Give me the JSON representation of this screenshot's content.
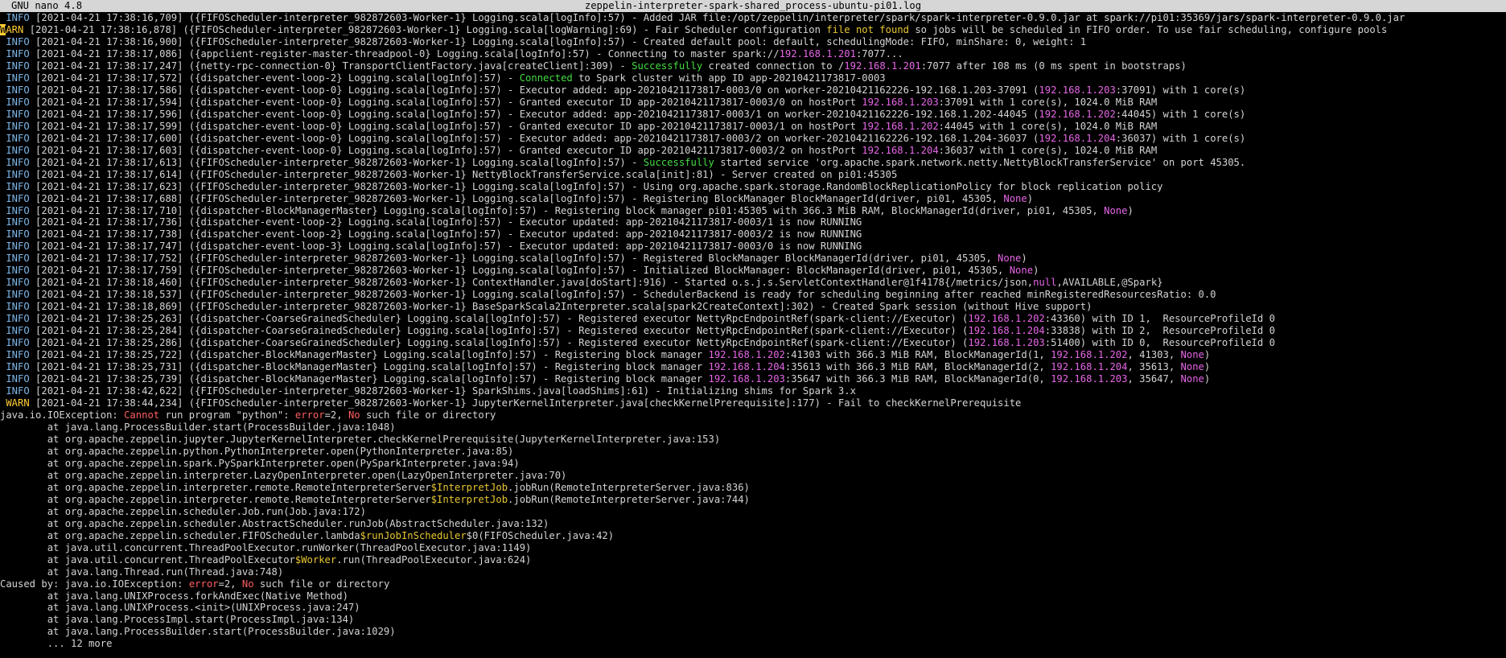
{
  "titlebar": {
    "app": "GNU nano 4.8",
    "filename": "zeppelin-interpreter-spark-shared_process-ubuntu-pi01.log"
  },
  "colors": {
    "background": "#000000",
    "titlebar_bg": "#d6d6d6",
    "plain": "#d4d4d4",
    "info": "#7eb6e8",
    "warn": "#ffcc33",
    "red": "#ff5f5f",
    "magenta": "#e666e6",
    "green": "#44dd44",
    "yellow": "#e8c832"
  },
  "lines": [
    [
      [
        "info",
        " INFO"
      ],
      [
        "",
        " [2021-04-21 17:38:16,709] ({FIFOScheduler-interpreter_982872603-Worker-1} Logging.scala[logInfo]:57) - Added JAR file:/opt/zeppelin/interpreter/spark/spark-interpreter-0.9.0.jar at spark://pi01:35369/jars/spark-interpreter-0.9.0.jar"
      ]
    ],
    [
      [
        "cursor",
        "W"
      ],
      [
        "warn",
        "ARN"
      ],
      [
        "",
        " [2021-04-21 17:38:16,878] ({FIFOScheduler-interpreter_982872603-Worker-1} Logging.scala[logWarning]:69) - Fair Scheduler configuration "
      ],
      [
        "yel",
        "file not found"
      ],
      [
        "",
        " so jobs will be scheduled in FIFO order. To use fair scheduling, configure pools"
      ]
    ],
    [
      [
        "info",
        " INFO"
      ],
      [
        "",
        " [2021-04-21 17:38:16,900] ({FIFOScheduler-interpreter_982872603-Worker-1} Logging.scala[logInfo]:57) - Created default pool: default, schedulingMode: FIFO, minShare: 0, weight: 1"
      ]
    ],
    [
      [
        "info",
        " INFO"
      ],
      [
        "",
        " [2021-04-21 17:38:17,086] ({appclient-register-master-threadpool-0} Logging.scala[logInfo]:57) - Connecting to master spark://"
      ],
      [
        "mag",
        "192.168.1.201"
      ],
      [
        "",
        ":7077..."
      ]
    ],
    [
      [
        "info",
        " INFO"
      ],
      [
        "",
        " [2021-04-21 17:38:17,247] ({netty-rpc-connection-0} TransportClientFactory.java[createClient]:309) - "
      ],
      [
        "grn",
        "Successfully"
      ],
      [
        "",
        " created connection to /"
      ],
      [
        "mag",
        "192.168.1.201"
      ],
      [
        "",
        ":7077 after 108 ms (0 ms spent in bootstraps)"
      ]
    ],
    [
      [
        "info",
        " INFO"
      ],
      [
        "",
        " [2021-04-21 17:38:17,572] ({dispatcher-event-loop-2} Logging.scala[logInfo]:57) - "
      ],
      [
        "grn",
        "Connected"
      ],
      [
        "",
        " to Spark cluster with app ID app-20210421173817-0003"
      ]
    ],
    [
      [
        "info",
        " INFO"
      ],
      [
        "",
        " [2021-04-21 17:38:17,586] ({dispatcher-event-loop-0} Logging.scala[logInfo]:57) - Executor added: app-20210421173817-0003/0 on worker-20210421162226-192.168.1.203-37091 ("
      ],
      [
        "mag",
        "192.168.1.203"
      ],
      [
        "",
        ":37091) with 1 core(s)"
      ]
    ],
    [
      [
        "info",
        " INFO"
      ],
      [
        "",
        " [2021-04-21 17:38:17,594] ({dispatcher-event-loop-0} Logging.scala[logInfo]:57) - Granted executor ID app-20210421173817-0003/0 on hostPort "
      ],
      [
        "mag",
        "192.168.1.203"
      ],
      [
        "",
        ":37091 with 1 core(s), 1024.0 MiB RAM"
      ]
    ],
    [
      [
        "info",
        " INFO"
      ],
      [
        "",
        " [2021-04-21 17:38:17,596] ({dispatcher-event-loop-0} Logging.scala[logInfo]:57) - Executor added: app-20210421173817-0003/1 on worker-20210421162226-192.168.1.202-44045 ("
      ],
      [
        "mag",
        "192.168.1.202"
      ],
      [
        "",
        ":44045) with 1 core(s)"
      ]
    ],
    [
      [
        "info",
        " INFO"
      ],
      [
        "",
        " [2021-04-21 17:38:17,599] ({dispatcher-event-loop-0} Logging.scala[logInfo]:57) - Granted executor ID app-20210421173817-0003/1 on hostPort "
      ],
      [
        "mag",
        "192.168.1.202"
      ],
      [
        "",
        ":44045 with 1 core(s), 1024.0 MiB RAM"
      ]
    ],
    [
      [
        "info",
        " INFO"
      ],
      [
        "",
        " [2021-04-21 17:38:17,600] ({dispatcher-event-loop-0} Logging.scala[logInfo]:57) - Executor added: app-20210421173817-0003/2 on worker-20210421162226-192.168.1.204-36037 ("
      ],
      [
        "mag",
        "192.168.1.204"
      ],
      [
        "",
        ":36037) with 1 core(s)"
      ]
    ],
    [
      [
        "info",
        " INFO"
      ],
      [
        "",
        " [2021-04-21 17:38:17,603] ({dispatcher-event-loop-0} Logging.scala[logInfo]:57) - Granted executor ID app-20210421173817-0003/2 on hostPort "
      ],
      [
        "mag",
        "192.168.1.204"
      ],
      [
        "",
        ":36037 with 1 core(s), 1024.0 MiB RAM"
      ]
    ],
    [
      [
        "info",
        " INFO"
      ],
      [
        "",
        " [2021-04-21 17:38:17,613] ({FIFOScheduler-interpreter_982872603-Worker-1} Logging.scala[logInfo]:57) - "
      ],
      [
        "grn",
        "Successfully"
      ],
      [
        "",
        " started service 'org.apache.spark.network.netty.NettyBlockTransferService' on port 45305."
      ]
    ],
    [
      [
        "info",
        " INFO"
      ],
      [
        "",
        " [2021-04-21 17:38:17,614] ({FIFOScheduler-interpreter_982872603-Worker-1} NettyBlockTransferService.scala[init]:81) - Server created on pi01:45305"
      ]
    ],
    [
      [
        "info",
        " INFO"
      ],
      [
        "",
        " [2021-04-21 17:38:17,623] ({FIFOScheduler-interpreter_982872603-Worker-1} Logging.scala[logInfo]:57) - Using org.apache.spark.storage.RandomBlockReplicationPolicy for block replication policy"
      ]
    ],
    [
      [
        "info",
        " INFO"
      ],
      [
        "",
        " [2021-04-21 17:38:17,688] ({FIFOScheduler-interpreter_982872603-Worker-1} Logging.scala[logInfo]:57) - Registering BlockManager BlockManagerId(driver, pi01, 45305, "
      ],
      [
        "mag",
        "None"
      ],
      [
        "",
        ")"
      ]
    ],
    [
      [
        "info",
        " INFO"
      ],
      [
        "",
        " [2021-04-21 17:38:17,710] ({dispatcher-BlockManagerMaster} Logging.scala[logInfo]:57) - Registering block manager pi01:45305 with 366.3 MiB RAM, BlockManagerId(driver, pi01, 45305, "
      ],
      [
        "mag",
        "None"
      ],
      [
        "",
        ")"
      ]
    ],
    [
      [
        "info",
        " INFO"
      ],
      [
        "",
        " [2021-04-21 17:38:17,736] ({dispatcher-event-loop-2} Logging.scala[logInfo]:57) - Executor updated: app-20210421173817-0003/1 is now RUNNING"
      ]
    ],
    [
      [
        "info",
        " INFO"
      ],
      [
        "",
        " [2021-04-21 17:38:17,738] ({dispatcher-event-loop-2} Logging.scala[logInfo]:57) - Executor updated: app-20210421173817-0003/2 is now RUNNING"
      ]
    ],
    [
      [
        "info",
        " INFO"
      ],
      [
        "",
        " [2021-04-21 17:38:17,747] ({dispatcher-event-loop-3} Logging.scala[logInfo]:57) - Executor updated: app-20210421173817-0003/0 is now RUNNING"
      ]
    ],
    [
      [
        "info",
        " INFO"
      ],
      [
        "",
        " [2021-04-21 17:38:17,752] ({FIFOScheduler-interpreter_982872603-Worker-1} Logging.scala[logInfo]:57) - Registered BlockManager BlockManagerId(driver, pi01, 45305, "
      ],
      [
        "mag",
        "None"
      ],
      [
        "",
        ")"
      ]
    ],
    [
      [
        "info",
        " INFO"
      ],
      [
        "",
        " [2021-04-21 17:38:17,759] ({FIFOScheduler-interpreter_982872603-Worker-1} Logging.scala[logInfo]:57) - Initialized BlockManager: BlockManagerId(driver, pi01, 45305, "
      ],
      [
        "mag",
        "None"
      ],
      [
        "",
        ")"
      ]
    ],
    [
      [
        "info",
        " INFO"
      ],
      [
        "",
        " [2021-04-21 17:38:18,460] ({FIFOScheduler-interpreter_982872603-Worker-1} ContextHandler.java[doStart]:916) - Started o.s.j.s.ServletContextHandler@1f4178{/metrics/json,"
      ],
      [
        "mag",
        "null"
      ],
      [
        "",
        ",AVAILABLE,@Spark}"
      ]
    ],
    [
      [
        "info",
        " INFO"
      ],
      [
        "",
        " [2021-04-21 17:38:18,537] ({FIFOScheduler-interpreter_982872603-Worker-1} Logging.scala[logInfo]:57) - SchedulerBackend is ready for scheduling beginning after reached minRegisteredResourcesRatio: 0.0"
      ]
    ],
    [
      [
        "info",
        " INFO"
      ],
      [
        "",
        " [2021-04-21 17:38:18,869] ({FIFOScheduler-interpreter_982872603-Worker-1} BaseSparkScala2Interpreter.scala[spark2CreateContext]:302) - Created Spark session (without Hive support)"
      ]
    ],
    [
      [
        "info",
        " INFO"
      ],
      [
        "",
        " [2021-04-21 17:38:25,263] ({dispatcher-CoarseGrainedScheduler} Logging.scala[logInfo]:57) - Registered executor NettyRpcEndpointRef(spark-client://Executor) ("
      ],
      [
        "mag",
        "192.168.1.202"
      ],
      [
        "",
        ":43360) with ID 1,  ResourceProfileId 0"
      ]
    ],
    [
      [
        "info",
        " INFO"
      ],
      [
        "",
        " [2021-04-21 17:38:25,284] ({dispatcher-CoarseGrainedScheduler} Logging.scala[logInfo]:57) - Registered executor NettyRpcEndpointRef(spark-client://Executor) ("
      ],
      [
        "mag",
        "192.168.1.204"
      ],
      [
        "",
        ":33838) with ID 2,  ResourceProfileId 0"
      ]
    ],
    [
      [
        "info",
        " INFO"
      ],
      [
        "",
        " [2021-04-21 17:38:25,286] ({dispatcher-CoarseGrainedScheduler} Logging.scala[logInfo]:57) - Registered executor NettyRpcEndpointRef(spark-client://Executor) ("
      ],
      [
        "mag",
        "192.168.1.203"
      ],
      [
        "",
        ":51400) with ID 0,  ResourceProfileId 0"
      ]
    ],
    [
      [
        "info",
        " INFO"
      ],
      [
        "",
        " [2021-04-21 17:38:25,722] ({dispatcher-BlockManagerMaster} Logging.scala[logInfo]:57) - Registering block manager "
      ],
      [
        "mag",
        "192.168.1.202"
      ],
      [
        "",
        ":41303 with 366.3 MiB RAM, BlockManagerId(1, "
      ],
      [
        "mag",
        "192.168.1.202"
      ],
      [
        "",
        ", 41303, "
      ],
      [
        "mag",
        "None"
      ],
      [
        "",
        ")"
      ]
    ],
    [
      [
        "info",
        " INFO"
      ],
      [
        "",
        " [2021-04-21 17:38:25,731] ({dispatcher-BlockManagerMaster} Logging.scala[logInfo]:57) - Registering block manager "
      ],
      [
        "mag",
        "192.168.1.204"
      ],
      [
        "",
        ":35613 with 366.3 MiB RAM, BlockManagerId(2, "
      ],
      [
        "mag",
        "192.168.1.204"
      ],
      [
        "",
        ", 35613, "
      ],
      [
        "mag",
        "None"
      ],
      [
        "",
        ")"
      ]
    ],
    [
      [
        "info",
        " INFO"
      ],
      [
        "",
        " [2021-04-21 17:38:25,739] ({dispatcher-BlockManagerMaster} Logging.scala[logInfo]:57) - Registering block manager "
      ],
      [
        "mag",
        "192.168.1.203"
      ],
      [
        "",
        ":35647 with 366.3 MiB RAM, BlockManagerId(0, "
      ],
      [
        "mag",
        "192.168.1.203"
      ],
      [
        "",
        ", 35647, "
      ],
      [
        "mag",
        "None"
      ],
      [
        "",
        ")"
      ]
    ],
    [
      [
        "info",
        " INFO"
      ],
      [
        "",
        " [2021-04-21 17:38:42,622] ({FIFOScheduler-interpreter_982872603-Worker-1} SparkShims.java[loadShims]:61) - Initializing shims for Spark 3.x"
      ]
    ],
    [
      [
        "warn",
        " WARN"
      ],
      [
        "",
        " [2021-04-21 17:38:44,234] ({FIFOScheduler-interpreter_982872603-Worker-1} JupyterKernelInterpreter.java[checkKernelPrerequisite]:177) - Fail to checkKernelPrerequisite"
      ]
    ],
    [
      [
        "",
        "java.io.IOException: "
      ],
      [
        "red",
        "Cannot"
      ],
      [
        "",
        " run program \"python\": "
      ],
      [
        "red",
        "error"
      ],
      [
        "",
        "=2, "
      ],
      [
        "red",
        "No"
      ],
      [
        "",
        " such file or directory"
      ]
    ],
    [
      [
        "",
        "        at java.lang.ProcessBuilder.start(ProcessBuilder.java:1048)"
      ]
    ],
    [
      [
        "",
        "        at org.apache.zeppelin.jupyter.JupyterKernelInterpreter.checkKernelPrerequisite(JupyterKernelInterpreter.java:153)"
      ]
    ],
    [
      [
        "",
        "        at org.apache.zeppelin.python.PythonInterpreter.open(PythonInterpreter.java:85)"
      ]
    ],
    [
      [
        "",
        "        at org.apache.zeppelin.spark.PySparkInterpreter.open(PySparkInterpreter.java:94)"
      ]
    ],
    [
      [
        "",
        "        at org.apache.zeppelin.interpreter.LazyOpenInterpreter.open(LazyOpenInterpreter.java:70)"
      ]
    ],
    [
      [
        "",
        "        at org.apache.zeppelin.interpreter.remote.RemoteInterpreterServer"
      ],
      [
        "yel",
        "$InterpretJob"
      ],
      [
        "",
        ".jobRun(RemoteInterpreterServer.java:836)"
      ]
    ],
    [
      [
        "",
        "        at org.apache.zeppelin.interpreter.remote.RemoteInterpreterServer"
      ],
      [
        "yel",
        "$InterpretJob"
      ],
      [
        "",
        ".jobRun(RemoteInterpreterServer.java:744)"
      ]
    ],
    [
      [
        "",
        "        at org.apache.zeppelin.scheduler.Job.run(Job.java:172)"
      ]
    ],
    [
      [
        "",
        "        at org.apache.zeppelin.scheduler.AbstractScheduler.runJob(AbstractScheduler.java:132)"
      ]
    ],
    [
      [
        "",
        "        at org.apache.zeppelin.scheduler.FIFOScheduler.lambda"
      ],
      [
        "yel",
        "$runJobInScheduler"
      ],
      [
        "",
        "$0(FIFOScheduler.java:42)"
      ]
    ],
    [
      [
        "",
        "        at java.util.concurrent.ThreadPoolExecutor.runWorker(ThreadPoolExecutor.java:1149)"
      ]
    ],
    [
      [
        "",
        "        at java.util.concurrent.ThreadPoolExecutor"
      ],
      [
        "yel",
        "$Worker"
      ],
      [
        "",
        ".run(ThreadPoolExecutor.java:624)"
      ]
    ],
    [
      [
        "",
        "        at java.lang.Thread.run(Thread.java:748)"
      ]
    ],
    [
      [
        "",
        "Caused by: java.io.IOException: "
      ],
      [
        "red",
        "error"
      ],
      [
        "",
        "=2, "
      ],
      [
        "red",
        "No"
      ],
      [
        "",
        " such file or directory"
      ]
    ],
    [
      [
        "",
        "        at java.lang.UNIXProcess.forkAndExec(Native Method)"
      ]
    ],
    [
      [
        "",
        "        at java.lang.UNIXProcess.<init>(UNIXProcess.java:247)"
      ]
    ],
    [
      [
        "",
        "        at java.lang.ProcessImpl.start(ProcessImpl.java:134)"
      ]
    ],
    [
      [
        "",
        "        at java.lang.ProcessBuilder.start(ProcessBuilder.java:1029)"
      ]
    ],
    [
      [
        "",
        "        ... 12 more"
      ]
    ]
  ]
}
